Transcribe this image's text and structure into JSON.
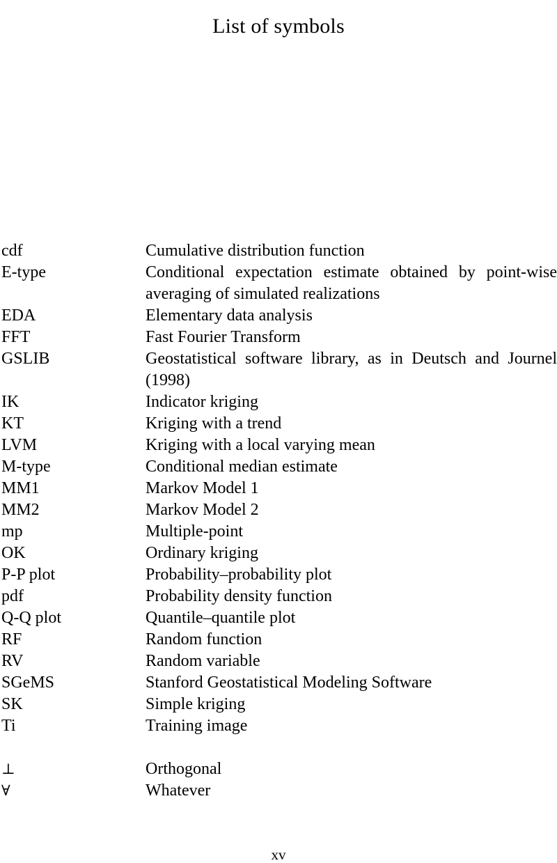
{
  "page": {
    "title": "List of symbols",
    "folio": "xv"
  },
  "entries": [
    {
      "term": "cdf",
      "definition": "Cumulative distribution function",
      "multiline": false
    },
    {
      "term": "E-type",
      "definition": "Conditional expectation estimate obtained by point-wise averaging of simulated realizations",
      "multiline": true
    },
    {
      "term": "EDA",
      "definition": "Elementary data analysis",
      "multiline": false
    },
    {
      "term": "FFT",
      "definition": "Fast Fourier Transform",
      "multiline": false
    },
    {
      "term": "GSLIB",
      "definition": "Geostatistical software library, as in Deutsch and Journel (1998)",
      "multiline": true
    },
    {
      "term": "IK",
      "definition": "Indicator kriging",
      "multiline": false
    },
    {
      "term": "KT",
      "definition": "Kriging with a trend",
      "multiline": false
    },
    {
      "term": "LVM",
      "definition": "Kriging with a local varying mean",
      "multiline": false
    },
    {
      "term": "M-type",
      "definition": "Conditional median estimate",
      "multiline": false
    },
    {
      "term": "MM1",
      "definition": "Markov Model 1",
      "multiline": false
    },
    {
      "term": "MM2",
      "definition": "Markov Model 2",
      "multiline": false
    },
    {
      "term": "mp",
      "definition": "Multiple-point",
      "multiline": false
    },
    {
      "term": "OK",
      "definition": "Ordinary kriging",
      "multiline": false
    },
    {
      "term": "P-P plot",
      "definition": "Probability–probability plot",
      "multiline": false
    },
    {
      "term": "pdf",
      "definition": "Probability density function",
      "multiline": false
    },
    {
      "term": "Q-Q plot",
      "definition": "Quantile–quantile plot",
      "multiline": false
    },
    {
      "term": "RF",
      "definition": "Random function",
      "multiline": false
    },
    {
      "term": "RV",
      "definition": "Random variable",
      "multiline": false
    },
    {
      "term": "SGeMS",
      "definition": "Stanford Geostatistical Modeling Software",
      "multiline": false
    },
    {
      "term": "SK",
      "definition": "Simple kriging",
      "multiline": false
    },
    {
      "term": "Ti",
      "definition": "Training image",
      "multiline": false
    },
    {
      "term": "",
      "definition": "",
      "spacer": true
    },
    {
      "term": "⊥",
      "definition": "Orthogonal",
      "multiline": false,
      "math": true
    },
    {
      "term": "∀",
      "definition": "Whatever",
      "multiline": false,
      "math": true
    }
  ]
}
